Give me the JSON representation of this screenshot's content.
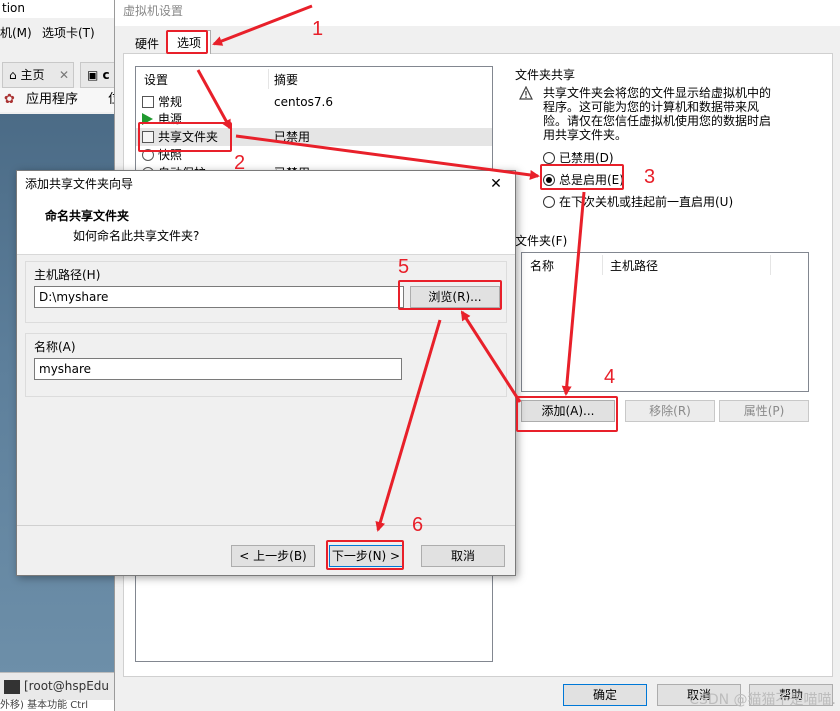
{
  "background_app": {
    "title_fragment": "tion",
    "menu": [
      "机(M)",
      "选项卡(T)"
    ],
    "tabs": [
      "主页",
      "c"
    ],
    "toolbar": [
      "应用程序",
      "位"
    ],
    "terminal": "[root@hspEdu",
    "bottom_text": "外移) 基本功能 Ctrl"
  },
  "vm_dialog": {
    "title": "虚拟机设置",
    "tabs": [
      "硬件",
      "选项"
    ],
    "list_headers": {
      "setting": "设置",
      "summary": "摘要"
    },
    "rows": [
      {
        "name": "常规",
        "summary": "centos7.6",
        "icon": "general-icon"
      },
      {
        "name": "电源",
        "summary": "",
        "icon": "power-icon"
      },
      {
        "name": "共享文件夹",
        "summary": "已禁用",
        "icon": "shared-folder-icon"
      },
      {
        "name": "快照",
        "summary": "",
        "icon": "snapshot-icon"
      },
      {
        "name": "自动保护",
        "summary": "已禁用",
        "icon": "autoprotect-icon"
      }
    ],
    "share_group": "文件夹共享",
    "warning": "共享文件夹会将您的文件显示给虚拟机中的程序。这可能为您的计算机和数据带来风险。请仅在您信任虚拟机使用您的数据时启用共享文件夹。",
    "radio_options": [
      "已禁用(D)",
      "总是启用(E)",
      "在下次关机或挂起前一直启用(U)"
    ],
    "selected_radio": 1,
    "folders_label": "文件夹(F)",
    "folder_columns": [
      "名称",
      "主机路径"
    ],
    "buttons": {
      "add": "添加(A)...",
      "remove": "移除(R)",
      "properties": "属性(P)"
    },
    "footer": {
      "ok": "确定",
      "cancel": "取消",
      "help": "帮助"
    }
  },
  "wizard": {
    "title": "添加共享文件夹向导",
    "heading": "命名共享文件夹",
    "subheading": "如何命名此共享文件夹?",
    "host_path_label": "主机路径(H)",
    "host_path_value": "D:\\myshare",
    "browse_button": "浏览(R)...",
    "name_label": "名称(A)",
    "name_value": "myshare",
    "back_button": "< 上一步(B)",
    "next_button": "下一步(N) >",
    "cancel_button": "取消"
  },
  "annotations": {
    "numbers": [
      "1",
      "2",
      "3",
      "4",
      "5",
      "6"
    ],
    "color": "#e8202a"
  },
  "watermark": "CSDN @猫猫不是喵喵."
}
